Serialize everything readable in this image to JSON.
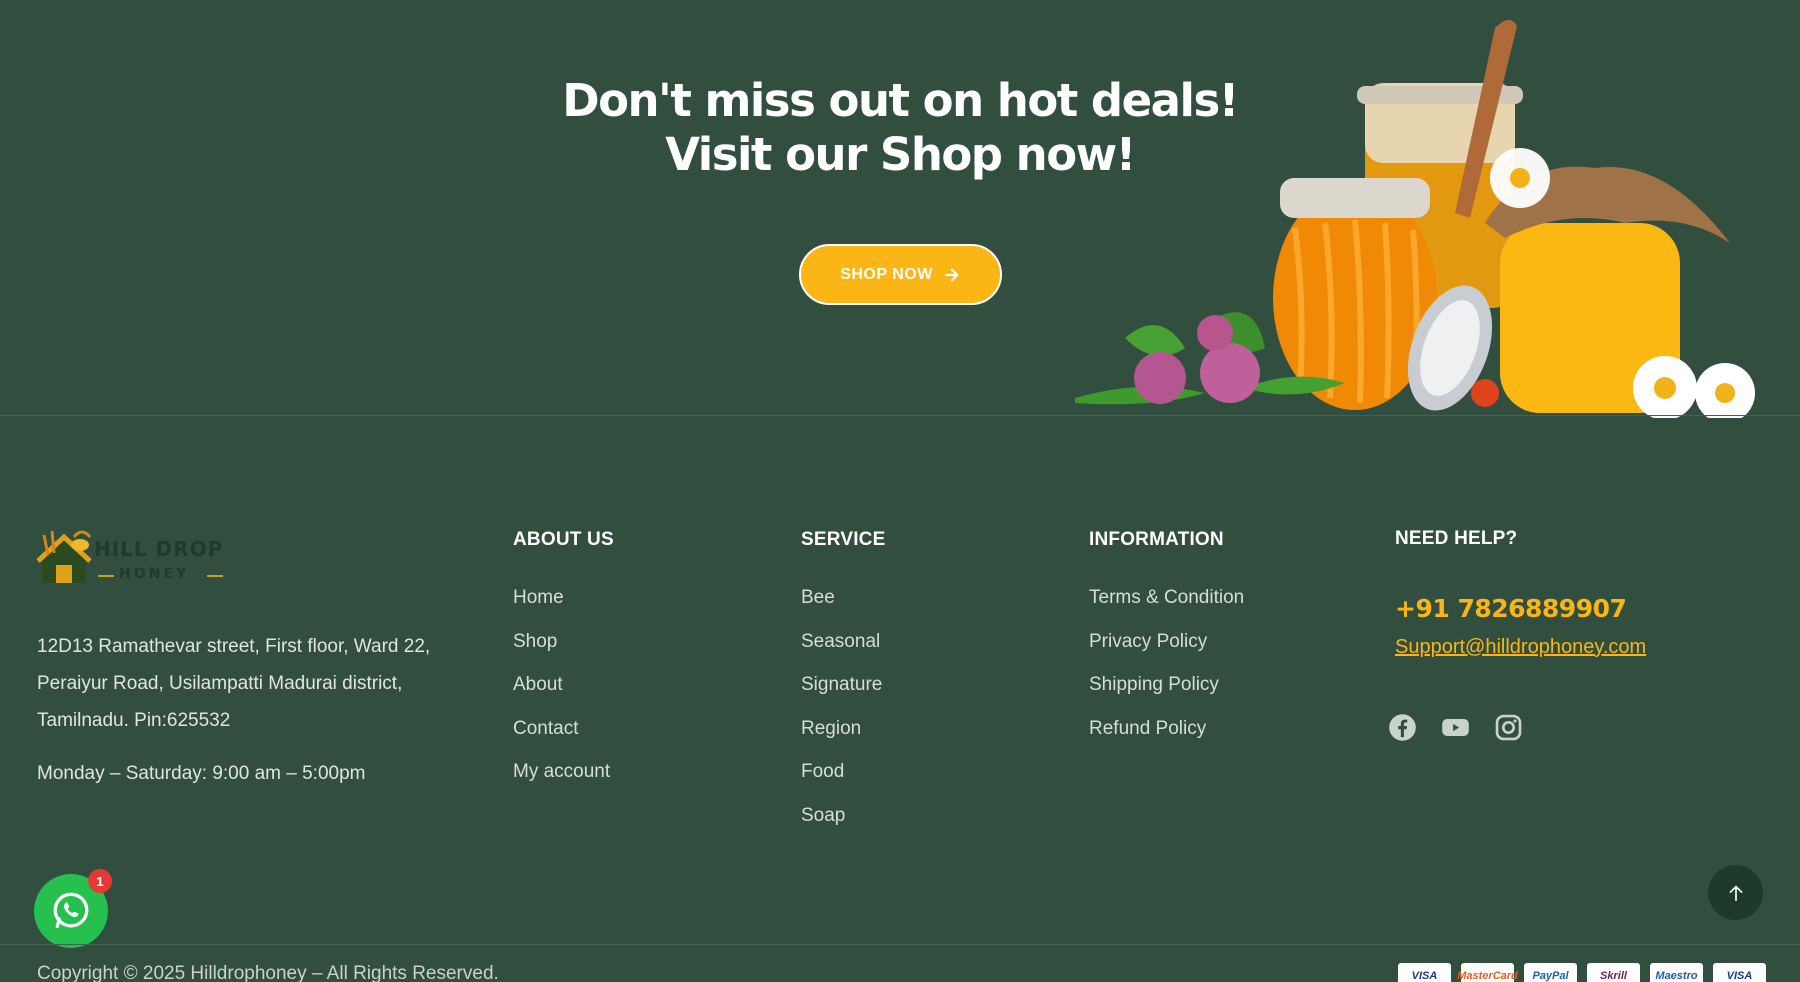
{
  "promo": {
    "title_line1": "Don't miss out on hot deals!",
    "title_line2": "Visit our Shop now!",
    "button_label": "SHOP NOW",
    "button_icon": "arrow-right-icon"
  },
  "brand": {
    "name_line1": "HILL DROP",
    "name_line2": "HONEY"
  },
  "contact": {
    "address_lines": [
      "12D13 Ramathevar street, First floor, Ward 22,",
      "Peraiyur Road, Usilampatti Madurai district,",
      "Tamilnadu. Pin:625532"
    ],
    "hours": "Monday – Saturday: 9:00 am – 5:00pm"
  },
  "columns": {
    "about": {
      "title": "ABOUT US",
      "items": [
        "Home",
        "Shop",
        "About",
        "Contact",
        "My account"
      ]
    },
    "service": {
      "title": "SERVICE",
      "items": [
        "Bee",
        "Seasonal",
        "Signature",
        "Region",
        "Food",
        "Soap"
      ]
    },
    "information": {
      "title": "INFORMATION",
      "items": [
        "Terms & Condition",
        "Privacy Policy",
        "Shipping Policy",
        "Refund Policy"
      ]
    }
  },
  "help": {
    "title": "NEED HELP?",
    "phone": "+91 7826889907",
    "email": "Support@hilldrophoney.com",
    "socials": [
      "facebook-icon",
      "youtube-icon",
      "instagram-icon"
    ]
  },
  "whatsapp": {
    "badge": "1"
  },
  "footer": {
    "copyright": "Copyright © 2025 Hilldrophoney – All Rights Reserved.",
    "payments": [
      "VISA",
      "MasterCard",
      "PayPal",
      "Skrill",
      "Maestro",
      "VISA"
    ]
  },
  "colors": {
    "background": "#324e3f",
    "accent": "#fbb514",
    "whatsapp": "#26c04f"
  }
}
